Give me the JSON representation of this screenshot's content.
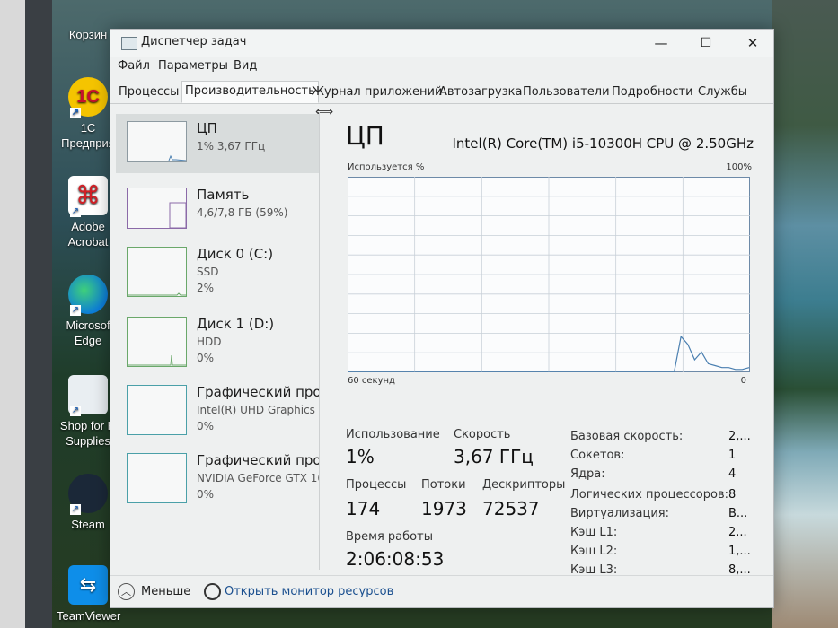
{
  "desktop": {
    "icons": [
      {
        "label": "Корзин",
        "icon": "recycle-bin-icon"
      },
      {
        "label": "1C\nПредприя",
        "icon": "1c-icon"
      },
      {
        "label": "Adobe\nAcrobat",
        "icon": "acrobat-icon"
      },
      {
        "label": "Microsof\nEdge",
        "icon": "edge-icon"
      },
      {
        "label": "Shop for H\nSupplies",
        "icon": "printer-icon"
      },
      {
        "label": "Steam",
        "icon": "steam-icon"
      },
      {
        "label": "TeamViewer",
        "icon": "teamviewer-icon"
      }
    ]
  },
  "window": {
    "title": "Диспетчер задач",
    "controls": {
      "minimize": "—",
      "maximize": "☐",
      "close": "✕"
    }
  },
  "menu": [
    "Файл",
    "Параметры",
    "Вид"
  ],
  "tabs": [
    {
      "label": "Процессы",
      "active": false
    },
    {
      "label": "Производительность",
      "active": true
    },
    {
      "label": "Журнал приложений",
      "active": false
    },
    {
      "label": "Автозагрузка",
      "active": false
    },
    {
      "label": "Пользователи",
      "active": false
    },
    {
      "label": "Подробности",
      "active": false
    },
    {
      "label": "Службы",
      "active": false
    }
  ],
  "sidebar": {
    "items": [
      {
        "title": "ЦП",
        "sub": "1% 3,67 ГГц",
        "sub2": "",
        "selected": true
      },
      {
        "title": "Память",
        "sub": "4,6/7,8 ГБ (59%)",
        "sub2": "",
        "selected": false
      },
      {
        "title": "Диск 0 (C:)",
        "sub": "SSD",
        "sub2": "2%",
        "selected": false
      },
      {
        "title": "Диск 1 (D:)",
        "sub": "HDD",
        "sub2": "0%",
        "selected": false
      },
      {
        "title": "Графический про",
        "sub": "Intel(R) UHD Graphics",
        "sub2": "0%",
        "selected": false
      },
      {
        "title": "Графический про",
        "sub": "NVIDIA GeForce GTX 16",
        "sub2": "0%",
        "selected": false
      }
    ]
  },
  "main": {
    "heading": "ЦП",
    "model": "Intel(R) Core(TM) i5-10300H CPU @ 2.50GHz",
    "graph": {
      "label_top_left": "Используется %",
      "label_top_right": "100%",
      "label_bottom_left": "60 секунд",
      "label_bottom_right": "0",
      "usage_percent": [
        0,
        0,
        0,
        0,
        0,
        0,
        0,
        0,
        0,
        0,
        0,
        0,
        0,
        0,
        0,
        0,
        0,
        0,
        0,
        0,
        0,
        0,
        0,
        0,
        0,
        0,
        0,
        0,
        0,
        0,
        0,
        0,
        0,
        0,
        0,
        0,
        0,
        0,
        0,
        0,
        0,
        0,
        0,
        0,
        0,
        0,
        0,
        0,
        0,
        18,
        14,
        6,
        10,
        4,
        3,
        2,
        2,
        1,
        1,
        2
      ]
    },
    "stats": {
      "usage_label": "Использование",
      "usage_value": "1%",
      "speed_label": "Скорость",
      "speed_value": "3,67 ГГц",
      "processes_label": "Процессы",
      "processes_value": "174",
      "threads_label": "Потоки",
      "threads_value": "1973",
      "handles_label": "Дескрипторы",
      "handles_value": "72537",
      "uptime_label": "Время работы",
      "uptime_value": "2:06:08:53"
    },
    "specs": [
      {
        "label": "Базовая скорость:",
        "value": "2,..."
      },
      {
        "label": "Сокетов:",
        "value": "1"
      },
      {
        "label": "Ядра:",
        "value": "4"
      },
      {
        "label": "Логических процессоров:",
        "value": "8"
      },
      {
        "label": "Виртуализация:",
        "value": "В..."
      },
      {
        "label": "Кэш L1:",
        "value": "2..."
      },
      {
        "label": "Кэш L2:",
        "value": "1,..."
      },
      {
        "label": "Кэш L3:",
        "value": "8,..."
      }
    ]
  },
  "footer": {
    "less_label": "Меньше",
    "monitor_label": "Открыть монитор ресурсов"
  },
  "colors": {
    "graph_line": "#4a7fb0",
    "graph_grid": "#c8d0d8",
    "graph_border": "#6d8aa8"
  }
}
